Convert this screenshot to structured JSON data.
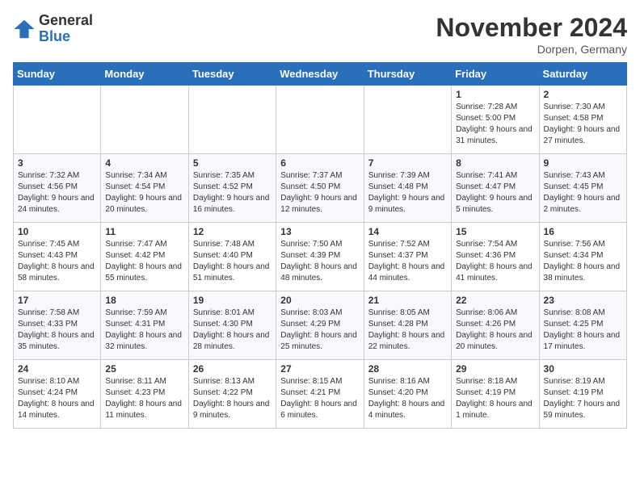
{
  "header": {
    "logo_general": "General",
    "logo_blue": "Blue",
    "month_title": "November 2024",
    "location": "Dorpen, Germany"
  },
  "weekdays": [
    "Sunday",
    "Monday",
    "Tuesday",
    "Wednesday",
    "Thursday",
    "Friday",
    "Saturday"
  ],
  "weeks": [
    [
      {
        "day": "",
        "info": ""
      },
      {
        "day": "",
        "info": ""
      },
      {
        "day": "",
        "info": ""
      },
      {
        "day": "",
        "info": ""
      },
      {
        "day": "",
        "info": ""
      },
      {
        "day": "1",
        "info": "Sunrise: 7:28 AM\nSunset: 5:00 PM\nDaylight: 9 hours and 31 minutes."
      },
      {
        "day": "2",
        "info": "Sunrise: 7:30 AM\nSunset: 4:58 PM\nDaylight: 9 hours and 27 minutes."
      }
    ],
    [
      {
        "day": "3",
        "info": "Sunrise: 7:32 AM\nSunset: 4:56 PM\nDaylight: 9 hours and 24 minutes."
      },
      {
        "day": "4",
        "info": "Sunrise: 7:34 AM\nSunset: 4:54 PM\nDaylight: 9 hours and 20 minutes."
      },
      {
        "day": "5",
        "info": "Sunrise: 7:35 AM\nSunset: 4:52 PM\nDaylight: 9 hours and 16 minutes."
      },
      {
        "day": "6",
        "info": "Sunrise: 7:37 AM\nSunset: 4:50 PM\nDaylight: 9 hours and 12 minutes."
      },
      {
        "day": "7",
        "info": "Sunrise: 7:39 AM\nSunset: 4:48 PM\nDaylight: 9 hours and 9 minutes."
      },
      {
        "day": "8",
        "info": "Sunrise: 7:41 AM\nSunset: 4:47 PM\nDaylight: 9 hours and 5 minutes."
      },
      {
        "day": "9",
        "info": "Sunrise: 7:43 AM\nSunset: 4:45 PM\nDaylight: 9 hours and 2 minutes."
      }
    ],
    [
      {
        "day": "10",
        "info": "Sunrise: 7:45 AM\nSunset: 4:43 PM\nDaylight: 8 hours and 58 minutes."
      },
      {
        "day": "11",
        "info": "Sunrise: 7:47 AM\nSunset: 4:42 PM\nDaylight: 8 hours and 55 minutes."
      },
      {
        "day": "12",
        "info": "Sunrise: 7:48 AM\nSunset: 4:40 PM\nDaylight: 8 hours and 51 minutes."
      },
      {
        "day": "13",
        "info": "Sunrise: 7:50 AM\nSunset: 4:39 PM\nDaylight: 8 hours and 48 minutes."
      },
      {
        "day": "14",
        "info": "Sunrise: 7:52 AM\nSunset: 4:37 PM\nDaylight: 8 hours and 44 minutes."
      },
      {
        "day": "15",
        "info": "Sunrise: 7:54 AM\nSunset: 4:36 PM\nDaylight: 8 hours and 41 minutes."
      },
      {
        "day": "16",
        "info": "Sunrise: 7:56 AM\nSunset: 4:34 PM\nDaylight: 8 hours and 38 minutes."
      }
    ],
    [
      {
        "day": "17",
        "info": "Sunrise: 7:58 AM\nSunset: 4:33 PM\nDaylight: 8 hours and 35 minutes."
      },
      {
        "day": "18",
        "info": "Sunrise: 7:59 AM\nSunset: 4:31 PM\nDaylight: 8 hours and 32 minutes."
      },
      {
        "day": "19",
        "info": "Sunrise: 8:01 AM\nSunset: 4:30 PM\nDaylight: 8 hours and 28 minutes."
      },
      {
        "day": "20",
        "info": "Sunrise: 8:03 AM\nSunset: 4:29 PM\nDaylight: 8 hours and 25 minutes."
      },
      {
        "day": "21",
        "info": "Sunrise: 8:05 AM\nSunset: 4:28 PM\nDaylight: 8 hours and 22 minutes."
      },
      {
        "day": "22",
        "info": "Sunrise: 8:06 AM\nSunset: 4:26 PM\nDaylight: 8 hours and 20 minutes."
      },
      {
        "day": "23",
        "info": "Sunrise: 8:08 AM\nSunset: 4:25 PM\nDaylight: 8 hours and 17 minutes."
      }
    ],
    [
      {
        "day": "24",
        "info": "Sunrise: 8:10 AM\nSunset: 4:24 PM\nDaylight: 8 hours and 14 minutes."
      },
      {
        "day": "25",
        "info": "Sunrise: 8:11 AM\nSunset: 4:23 PM\nDaylight: 8 hours and 11 minutes."
      },
      {
        "day": "26",
        "info": "Sunrise: 8:13 AM\nSunset: 4:22 PM\nDaylight: 8 hours and 9 minutes."
      },
      {
        "day": "27",
        "info": "Sunrise: 8:15 AM\nSunset: 4:21 PM\nDaylight: 8 hours and 6 minutes."
      },
      {
        "day": "28",
        "info": "Sunrise: 8:16 AM\nSunset: 4:20 PM\nDaylight: 8 hours and 4 minutes."
      },
      {
        "day": "29",
        "info": "Sunrise: 8:18 AM\nSunset: 4:19 PM\nDaylight: 8 hours and 1 minute."
      },
      {
        "day": "30",
        "info": "Sunrise: 8:19 AM\nSunset: 4:19 PM\nDaylight: 7 hours and 59 minutes."
      }
    ]
  ]
}
